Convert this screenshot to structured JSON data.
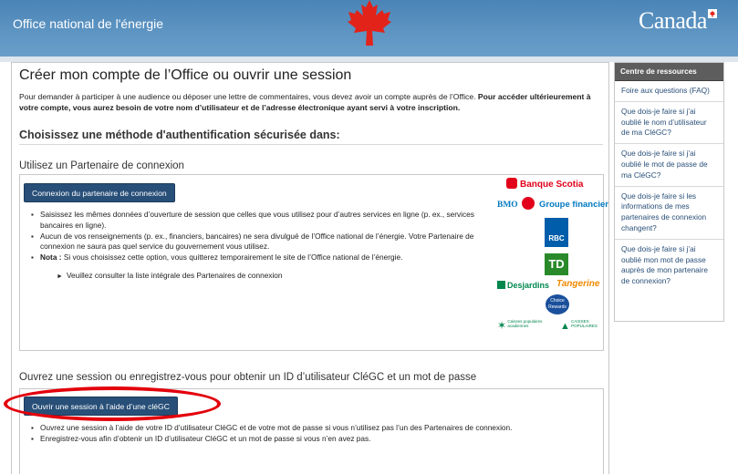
{
  "header": {
    "title": "Office national de l'énergie",
    "wordmark": "Canada"
  },
  "page": {
    "title": "Créer mon compte de l’Office ou ouvrir une session",
    "intro_regular": "Pour demander à participer à une audience ou déposer une lettre de commentaires, vous devez avoir un compte auprès de l’Office. ",
    "intro_bold": "Pour accéder ultérieurement à votre compte, vous aurez besoin de votre nom d’utilisateur et de l’adresse électronique ayant servi à votre inscription.",
    "auth_heading": "Choisissez une méthode d'authentification sécurisée dans:"
  },
  "partner": {
    "heading": "Utilisez un Partenaire de connexion",
    "button_label": "Connexion du partenaire de connexion",
    "bullets": [
      "Saisissez les mêmes données d’ouverture de session que celles que vous utilisez pour d’autres services en ligne (p. ex., services bancaires en ligne).",
      "Aucun de vos renseignements (p. ex., financiers, bancaires) ne sera divulgué de l’Office national de l’énergie. Votre Partenaire de connexion ne saura pas quel service du gouvernement vous utilisez."
    ],
    "note_label": "Nota :",
    "note_text": " Si vous choisissez cette option, vous quitterez temporairement le site de l’Office national de l’énergie.",
    "more_link": "Veuillez consulter la liste intégrale des Partenaires de connexion",
    "logos": {
      "scotia": "Banque Scotia",
      "bmo": "BMO",
      "bmo_group": "Groupe financier",
      "rbc": "RBC",
      "td": "TD",
      "desjardins": "Desjardins",
      "tangerine": "Tangerine",
      "choice_rewards_1": "Choice",
      "choice_rewards_2": "Rewards",
      "caisses_1a": "Caisses populaires",
      "caisses_1b": "acadiennes",
      "caisses_2a": "CAISSES",
      "caisses_2b": "POPULAIRES"
    },
    "colors": {
      "scotia": "#e2001a",
      "bmo": "#0079c1",
      "bmo_badge": "#e2001a",
      "rbc": "#005daa",
      "td": "#2a8a2a",
      "desjardins": "#00874e",
      "tangerine": "#f28a00"
    }
  },
  "clegc": {
    "heading": "Ouvrez une session ou enregistrez-vous pour obtenir un ID d’utilisateur CléGC et un mot de passe",
    "button_label": "Ouvrir une session à l’aide d’une cléGC",
    "bullets": [
      "Ouvrez une session à l’aide de votre ID d’utilisateur CléGC et de votre mot de passe si vous n’utilisez pas l’un des Partenaires de connexion.",
      "Enregistrez-vous afin d’obtenir un ID d’utilisateur CléGC et un mot de passe si vous n’en avez pas."
    ]
  },
  "sidebar": {
    "heading": "Centre de ressources",
    "items": [
      {
        "label": "Foire aux questions (FAQ)"
      },
      {
        "label": "Que dois-je faire si j’ai oublié le nom d’utilisateur de ma CléGC?"
      },
      {
        "label": "Que dois-je faire si j’ai oublié le mot de passe de ma CléGC?"
      },
      {
        "label": "Que dois-je faire si les informations de mes partenaires de connexion changent?"
      },
      {
        "label": "Que dois-je faire si j’ai oublié mon mot de passe auprès de mon partenaire de connexion?"
      }
    ]
  },
  "annotation": {
    "highlight_color": "#e3000b",
    "icons": [
      "maple-leaf-icon",
      "canada-flag-icon"
    ]
  }
}
